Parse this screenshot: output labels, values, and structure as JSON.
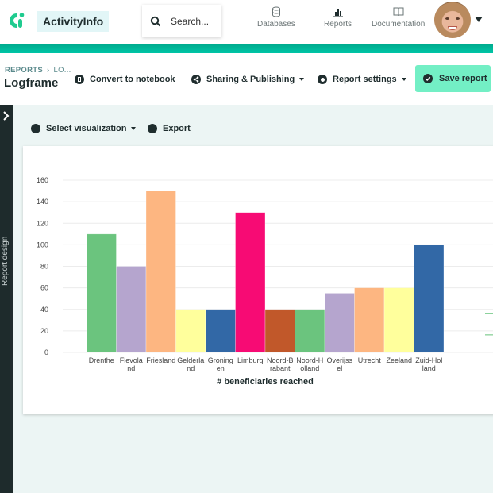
{
  "app": {
    "brand": "ActivityInfo",
    "search_placeholder": "Search...",
    "nav": [
      {
        "label": "Databases",
        "icon": "database-icon"
      },
      {
        "label": "Reports",
        "icon": "bar-chart-icon"
      },
      {
        "label": "Documentation",
        "icon": "book-icon"
      }
    ],
    "accent": "#00b89a"
  },
  "breadcrumb": {
    "root": "REPORTS",
    "current": "LO..."
  },
  "page_title": "Logframe",
  "toolbar": {
    "convert": "Convert to notebook",
    "sharing": "Sharing & Publishing",
    "settings": "Report settings",
    "save": "Save report"
  },
  "side_panel": {
    "label": "Report design"
  },
  "viz_toolbar": {
    "select": "Select visualization",
    "export": "Export"
  },
  "chart_data": {
    "type": "bar",
    "title": "",
    "xlabel": "# beneficiaries reached",
    "ylabel": "",
    "ylim": [
      0,
      160
    ],
    "yticks": [
      0,
      20,
      40,
      60,
      80,
      100,
      120,
      140,
      160
    ],
    "grid": true,
    "categories": [
      "Drenthe",
      "Flevoland",
      "Friesland",
      "Gelderland",
      "Groningen",
      "Limburg",
      "Noord-Brabant",
      "Noord-Holland",
      "Overijssel",
      "Utrecht",
      "Zeeland",
      "Zuid-Holland"
    ],
    "category_labels": [
      [
        "Drenthe"
      ],
      [
        "Flevola",
        "nd"
      ],
      [
        "Friesland"
      ],
      [
        "Gelderla",
        "nd"
      ],
      [
        "Groning",
        "en"
      ],
      [
        "Limburg"
      ],
      [
        "Noord-B",
        "rabant"
      ],
      [
        "Noord-H",
        "olland"
      ],
      [
        "Overijss",
        "el"
      ],
      [
        "Utrecht"
      ],
      [
        "Zeeland"
      ],
      [
        "Zuid-Hol",
        "land"
      ]
    ],
    "values": [
      110,
      80,
      150,
      40,
      40,
      130,
      40,
      40,
      55,
      60,
      60,
      100
    ],
    "colors": [
      "#66c27a",
      "#b3a2cc",
      "#fdb47d",
      "#ffff99",
      "#2b63a3",
      "#f7036f",
      "#bf5323",
      "#66c27a",
      "#b3a2cc",
      "#fdb47d",
      "#ffff99",
      "#2b63a3"
    ]
  }
}
